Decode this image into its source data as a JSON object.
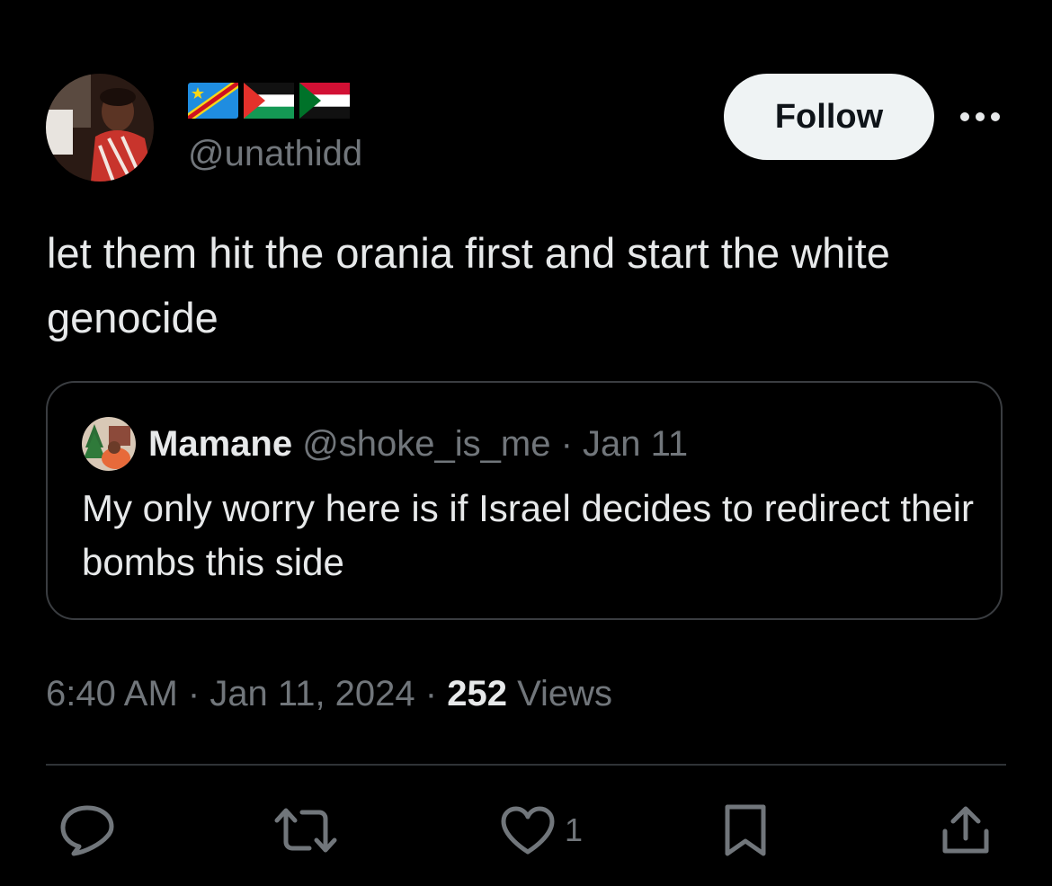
{
  "author": {
    "handle": "@unathidd",
    "flags": [
      "dr-congo-flag",
      "palestine-flag",
      "sudan-flag"
    ]
  },
  "follow_label": "Follow",
  "tweet_text": "let them hit the orania first and start the white genocide",
  "quoted": {
    "name": "Mamane",
    "handle": "@shoke_is_me",
    "separator": " · ",
    "date": "Jan 11",
    "text": "My only worry here is if Israel decides to redirect their bombs this side"
  },
  "meta": {
    "time": "6:40 AM",
    "date": "Jan 11, 2024",
    "views_count": "252",
    "views_label": " Views",
    "sep1": " · ",
    "sep2": " · "
  },
  "actions": {
    "like_count": "1"
  },
  "icons": [
    "more-icon",
    "reply-icon",
    "retweet-icon",
    "like-icon",
    "bookmark-icon",
    "share-icon"
  ],
  "colors": {
    "background": "#000000",
    "text": "#e7e9ea",
    "secondary": "#71767b",
    "follow_bg": "#eff3f4",
    "follow_text": "#0f1419",
    "border": "#2f3336"
  }
}
